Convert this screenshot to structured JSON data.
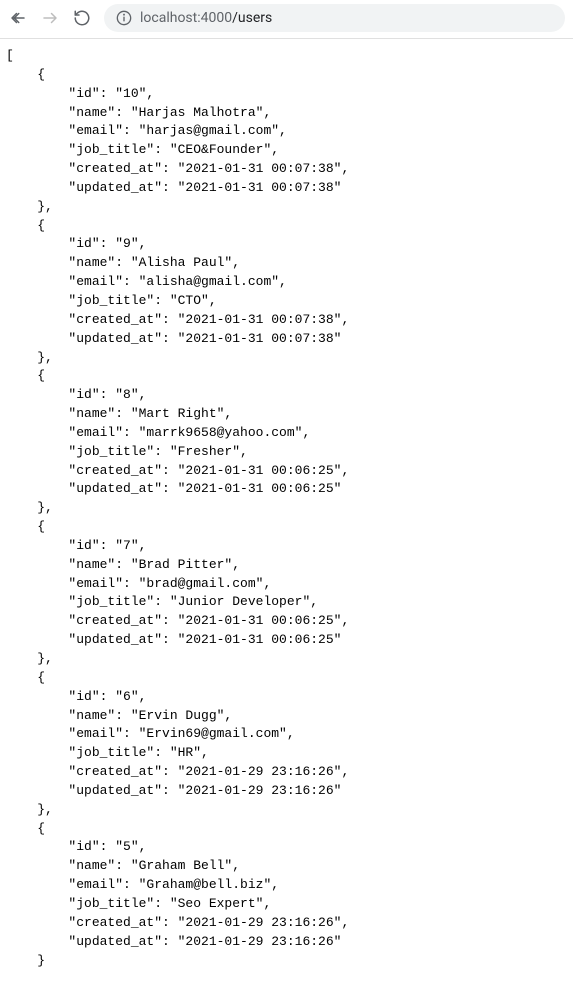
{
  "browser": {
    "url_host": "localhost:4000",
    "url_path": "/users"
  },
  "users": [
    {
      "id": "10",
      "name": "Harjas Malhotra",
      "email": "harjas@gmail.com",
      "job_title": "CEO&Founder",
      "created_at": "2021-01-31 00:07:38",
      "updated_at": "2021-01-31 00:07:38"
    },
    {
      "id": "9",
      "name": "Alisha Paul",
      "email": "alisha@gmail.com",
      "job_title": "CTO",
      "created_at": "2021-01-31 00:07:38",
      "updated_at": "2021-01-31 00:07:38"
    },
    {
      "id": "8",
      "name": "Mart Right",
      "email": "marrk9658@yahoo.com",
      "job_title": "Fresher",
      "created_at": "2021-01-31 00:06:25",
      "updated_at": "2021-01-31 00:06:25"
    },
    {
      "id": "7",
      "name": "Brad Pitter",
      "email": "brad@gmail.com",
      "job_title": "Junior Developer",
      "created_at": "2021-01-31 00:06:25",
      "updated_at": "2021-01-31 00:06:25"
    },
    {
      "id": "6",
      "name": "Ervin Dugg",
      "email": "Ervin69@gmail.com",
      "job_title": "HR",
      "created_at": "2021-01-29 23:16:26",
      "updated_at": "2021-01-29 23:16:26"
    },
    {
      "id": "5",
      "name": "Graham Bell",
      "email": "Graham@bell.biz",
      "job_title": "Seo Expert",
      "created_at": "2021-01-29 23:16:26",
      "updated_at": "2021-01-29 23:16:26"
    }
  ]
}
